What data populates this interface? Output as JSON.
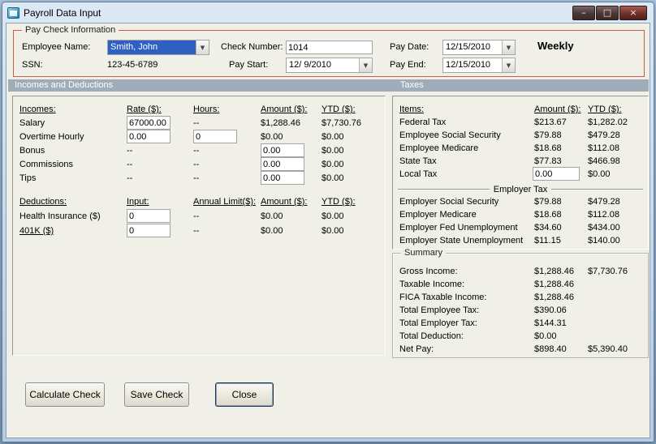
{
  "window": {
    "title": "Payroll Data Input",
    "controls": {
      "minimize": "–",
      "maximize": "□",
      "close": "×"
    }
  },
  "icons": {
    "dropdown_arrow": "▼"
  },
  "colors": {
    "selection": "#2E5FC3",
    "section_band": "#9FADBA",
    "paycheck_border": "#C2604B"
  },
  "paycheck": {
    "group_title": "Pay Check Information",
    "employee_name": {
      "label": "Employee Name:",
      "value": "Smith, John"
    },
    "ssn": {
      "label": "SSN:",
      "value": "123-45-6789"
    },
    "check_number": {
      "label": "Check Number:",
      "value": "1014"
    },
    "pay_start": {
      "label": "Pay Start:",
      "value": "12/ 9/2010"
    },
    "pay_date": {
      "label": "Pay Date:",
      "value": "12/15/2010"
    },
    "pay_end": {
      "label": "Pay End:",
      "value": "12/15/2010"
    },
    "frequency": "Weekly"
  },
  "bands": {
    "incomes_deductions": "Incomes and Deductions",
    "taxes": "Taxes"
  },
  "incomes": {
    "headers": {
      "name": "Incomes:",
      "rate": "Rate ($):",
      "hours": "Hours:",
      "amount": "Amount ($):",
      "ytd": "YTD ($):"
    },
    "salary": {
      "label": "Salary",
      "rate": "67000.00",
      "hours": "--",
      "amount": "$1,288.46",
      "ytd": "$7,730.76"
    },
    "overtime": {
      "label": "Overtime Hourly",
      "rate": "0.00",
      "hours": "0",
      "amount": "$0.00",
      "ytd": "$0.00"
    },
    "bonus": {
      "label": "Bonus",
      "rate": "--",
      "hours": "--",
      "amount": "0.00",
      "ytd": "$0.00"
    },
    "commissions": {
      "label": "Commissions",
      "rate": "--",
      "hours": "--",
      "amount": "0.00",
      "ytd": "$0.00"
    },
    "tips": {
      "label": "Tips",
      "rate": "--",
      "hours": "--",
      "amount": "0.00",
      "ytd": "$0.00"
    }
  },
  "deductions": {
    "headers": {
      "name": "Deductions:",
      "input": "Input:",
      "limit": "Annual Limit($):",
      "amount": "Amount ($):",
      "ytd": "YTD ($):"
    },
    "health_insurance": {
      "label": "Health Insurance  ($)",
      "input": "0",
      "limit": "--",
      "amount": "$0.00",
      "ytd": "$0.00"
    },
    "k401": {
      "label": "401K  ($)",
      "input": "0",
      "limit": "--",
      "amount": "$0.00",
      "ytd": "$0.00"
    }
  },
  "taxes": {
    "headers": {
      "items": "Items:",
      "amount": "Amount ($):",
      "ytd": "YTD ($):"
    },
    "federal": {
      "label": "Federal Tax",
      "amount": "$213.67",
      "ytd": "$1,282.02"
    },
    "employee_ss": {
      "label": "Employee Social Security",
      "amount": "$79.88",
      "ytd": "$479.28"
    },
    "employee_medicare": {
      "label": "Employee Medicare",
      "amount": "$18.68",
      "ytd": "$112.08"
    },
    "state": {
      "label": "State Tax",
      "amount": "$77.83",
      "ytd": "$466.98"
    },
    "local": {
      "label": "Local Tax",
      "amount": "0.00",
      "ytd": "$0.00"
    },
    "employer_divider": "Employer Tax",
    "employer_ss": {
      "label": "Employer Social Security",
      "amount": "$79.88",
      "ytd": "$479.28"
    },
    "employer_medicare": {
      "label": "Employer Medicare",
      "amount": "$18.68",
      "ytd": "$112.08"
    },
    "employer_fed_unemployment": {
      "label": "Employer Fed Unemployment",
      "amount": "$34.60",
      "ytd": "$434.00"
    },
    "employer_state_unemployment": {
      "label": "Employer State Unemployment",
      "amount": "$11.15",
      "ytd": "$140.00"
    }
  },
  "summary": {
    "group_title": "Summary",
    "gross_income": {
      "label": "Gross Income:",
      "amount": "$1,288.46",
      "ytd": "$7,730.76"
    },
    "taxable_income": {
      "label": "Taxable Income:",
      "amount": "$1,288.46"
    },
    "fica_taxable_income": {
      "label": "FICA Taxable Income:",
      "amount": "$1,288.46"
    },
    "total_employee_tax": {
      "label": "Total Employee Tax:",
      "amount": "$390.06"
    },
    "total_employer_tax": {
      "label": "Total Employer Tax:",
      "amount": "$144.31"
    },
    "total_deduction": {
      "label": "Total Deduction:",
      "amount": "$0.00"
    },
    "net_pay": {
      "label": "Net Pay:",
      "amount": "$898.40",
      "ytd": "$5,390.40"
    }
  },
  "buttons": {
    "calculate": "Calculate Check",
    "save": "Save Check",
    "close": "Close"
  }
}
